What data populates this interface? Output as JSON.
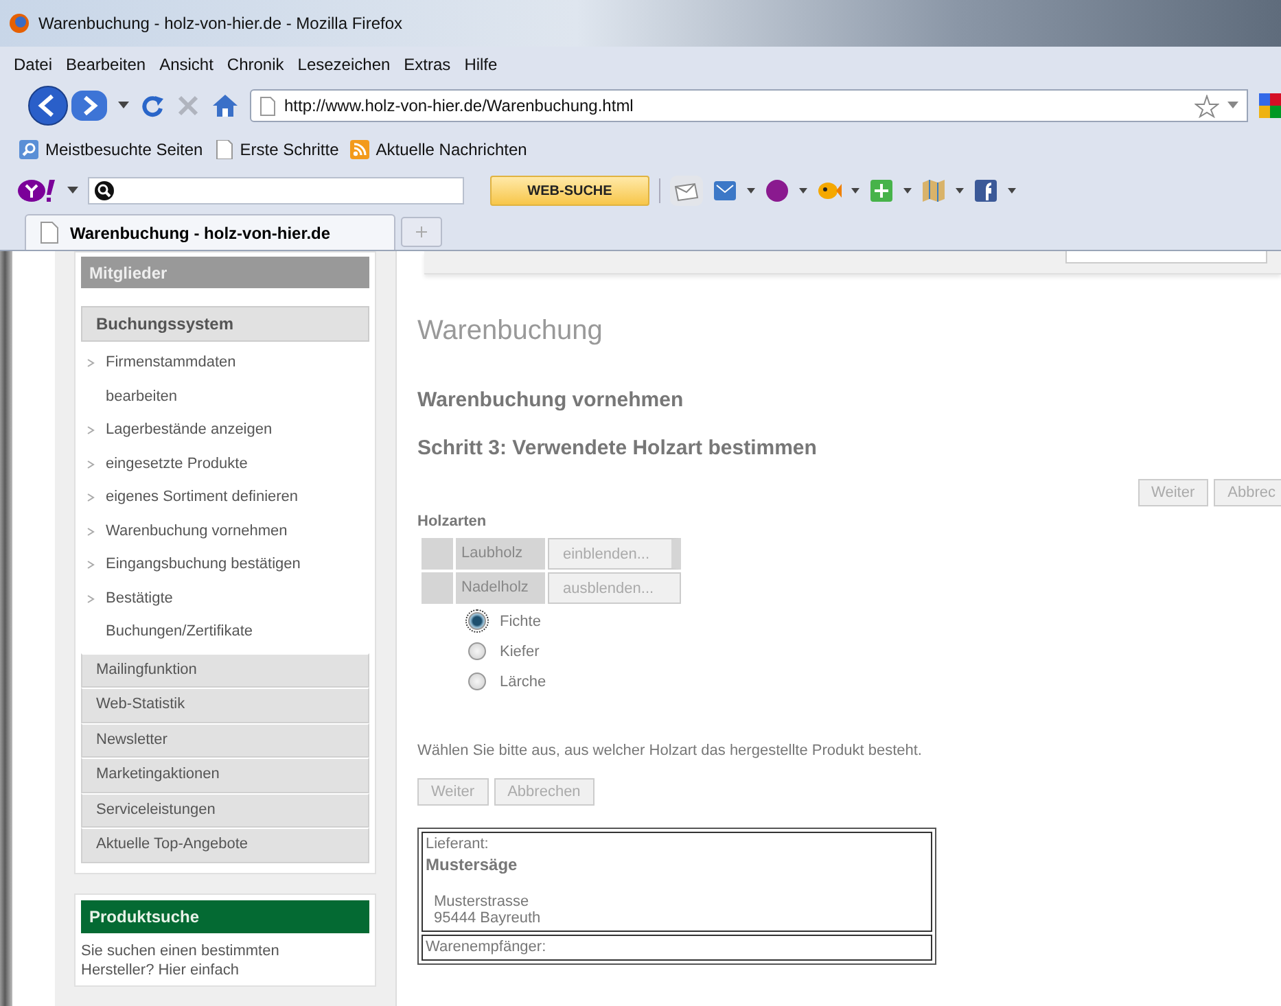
{
  "window": {
    "title": "Warenbuchung - holz-von-hier.de - Mozilla Firefox"
  },
  "menu": [
    "Datei",
    "Bearbeiten",
    "Ansicht",
    "Chronik",
    "Lesezeichen",
    "Extras",
    "Hilfe"
  ],
  "address_bar": {
    "value": "http://www.holz-von-hier.de/Warenbuchung.html"
  },
  "bookmarks": [
    {
      "label": "Meistbesuchte Seiten",
      "kind": "search"
    },
    {
      "label": "Erste Schritte",
      "kind": "page"
    },
    {
      "label": "Aktuelle Nachrichten",
      "kind": "feed"
    }
  ],
  "yahoo_toolbar": {
    "search_button": "WEB-SUCHE"
  },
  "tabs": [
    {
      "label": "Warenbuchung - holz-von-hier.de",
      "selected": true
    }
  ],
  "sidebar": {
    "members_header": "Mitglieder",
    "section": "Buchungssystem",
    "links": [
      "Firmenstammdaten\nbearbeiten",
      "Lagerbestände anzeigen",
      "eingesetzte Produkte",
      "eigenes Sortiment definieren",
      "Warenbuchung vornehmen",
      "Eingangsbuchung bestätigen",
      "Bestätigte\nBuchungen/Zertifikate"
    ],
    "menu_items": [
      "Mailingfunktion",
      "Web-Statistik",
      "Newsletter",
      "Marketingaktionen",
      "Serviceleistungen",
      "Aktuelle Top-Angebote"
    ],
    "search_box": {
      "title": "Produktsuche",
      "text": "Sie suchen einen bestimmten Hersteller? Hier einfach"
    }
  },
  "main": {
    "page_title": "Warenbuchung",
    "heading": "Warenbuchung vornehmen",
    "step": "Schritt 3: Verwendete Holzart bestimmen",
    "top_buttons": [
      "Weiter",
      "Abbrec"
    ],
    "group_label": "Holzarten",
    "categories": [
      {
        "label": "Laubholz",
        "toggle": "einblenden...",
        "expanded": false
      },
      {
        "label": "Nadelholz",
        "toggle": "ausblenden...",
        "expanded": true,
        "options": [
          {
            "label": "Fichte",
            "selected": true
          },
          {
            "label": "Kiefer",
            "selected": false
          },
          {
            "label": "Lärche",
            "selected": false
          }
        ]
      }
    ],
    "hint": "Wählen Sie bitte aus, aus welcher Holzart das hergestellte Produkt besteht.",
    "bottom_buttons": [
      "Weiter",
      "Abbrechen"
    ],
    "supplier": {
      "label": "Lieferant:",
      "name": "Mustersäge",
      "street": "Musterstrasse",
      "city": "95444 Bayreuth"
    },
    "recipient": {
      "label": "Warenempfänger:"
    }
  }
}
